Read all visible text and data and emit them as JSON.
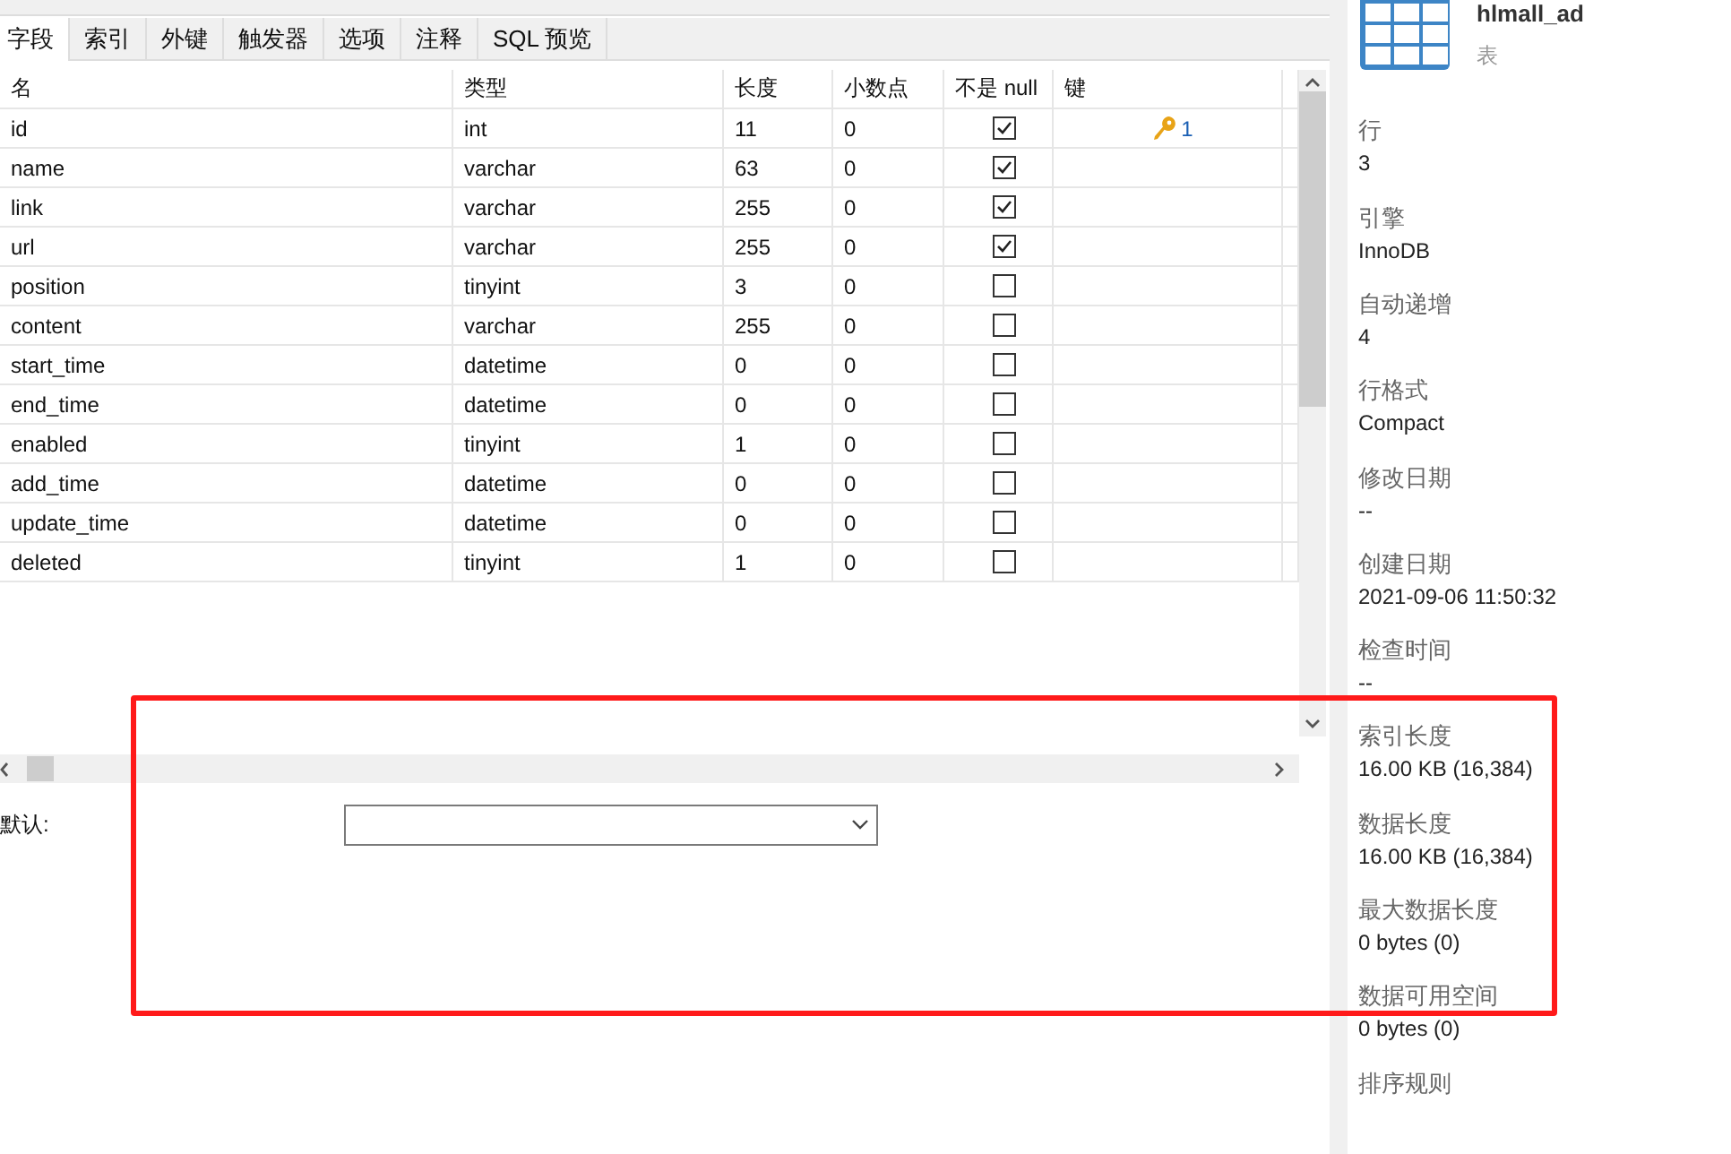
{
  "tabs": [
    {
      "label": "字段",
      "selected": true
    },
    {
      "label": "索引",
      "selected": false
    },
    {
      "label": "外键",
      "selected": false
    },
    {
      "label": "触发器",
      "selected": false
    },
    {
      "label": "选项",
      "selected": false
    },
    {
      "label": "注释",
      "selected": false
    },
    {
      "label": "SQL 预览",
      "selected": false
    }
  ],
  "table": {
    "columns": [
      "名",
      "类型",
      "长度",
      "小数点",
      "不是 null",
      "键"
    ],
    "rows": [
      {
        "name": "id",
        "type": "int",
        "length": "11",
        "decimals": "0",
        "not_null": true,
        "key": "1"
      },
      {
        "name": "name",
        "type": "varchar",
        "length": "63",
        "decimals": "0",
        "not_null": true
      },
      {
        "name": "link",
        "type": "varchar",
        "length": "255",
        "decimals": "0",
        "not_null": true
      },
      {
        "name": "url",
        "type": "varchar",
        "length": "255",
        "decimals": "0",
        "not_null": true
      },
      {
        "name": "position",
        "type": "tinyint",
        "length": "3",
        "decimals": "0",
        "not_null": false
      },
      {
        "name": "content",
        "type": "varchar",
        "length": "255",
        "decimals": "0",
        "not_null": false
      },
      {
        "name": "start_time",
        "type": "datetime",
        "length": "0",
        "decimals": "0",
        "not_null": false
      },
      {
        "name": "end_time",
        "type": "datetime",
        "length": "0",
        "decimals": "0",
        "not_null": false
      },
      {
        "name": "enabled",
        "type": "tinyint",
        "length": "1",
        "decimals": "0",
        "not_null": false
      },
      {
        "name": "add_time",
        "type": "datetime",
        "length": "0",
        "decimals": "0",
        "not_null": false
      },
      {
        "name": "update_time",
        "type": "datetime",
        "length": "0",
        "decimals": "0",
        "not_null": false
      },
      {
        "name": "deleted",
        "type": "tinyint",
        "length": "1",
        "decimals": "0",
        "not_null": false
      }
    ]
  },
  "default_field": {
    "label": "默认:"
  },
  "info_panel": {
    "title": "hlmall_ad",
    "subtitle": "表",
    "properties": [
      {
        "label": "行",
        "value": "3"
      },
      {
        "label": "引擎",
        "value": "InnoDB"
      },
      {
        "label": "自动递增",
        "value": "4"
      },
      {
        "label": "行格式",
        "value": "Compact"
      },
      {
        "label": "修改日期",
        "value": "--"
      },
      {
        "label": "创建日期",
        "value": "2021-09-06 11:50:32"
      },
      {
        "label": "检查时间",
        "value": "--"
      },
      {
        "label": "索引长度",
        "value": "16.00 KB (16,384)"
      },
      {
        "label": "数据长度",
        "value": "16.00 KB (16,384)"
      },
      {
        "label": "最大数据长度",
        "value": "0 bytes (0)"
      },
      {
        "label": "数据可用空间",
        "value": "0 bytes (0)"
      },
      {
        "label": "排序规则"
      }
    ]
  },
  "annotation": {
    "kind": "rectangle",
    "color": "#ff1a1a"
  }
}
